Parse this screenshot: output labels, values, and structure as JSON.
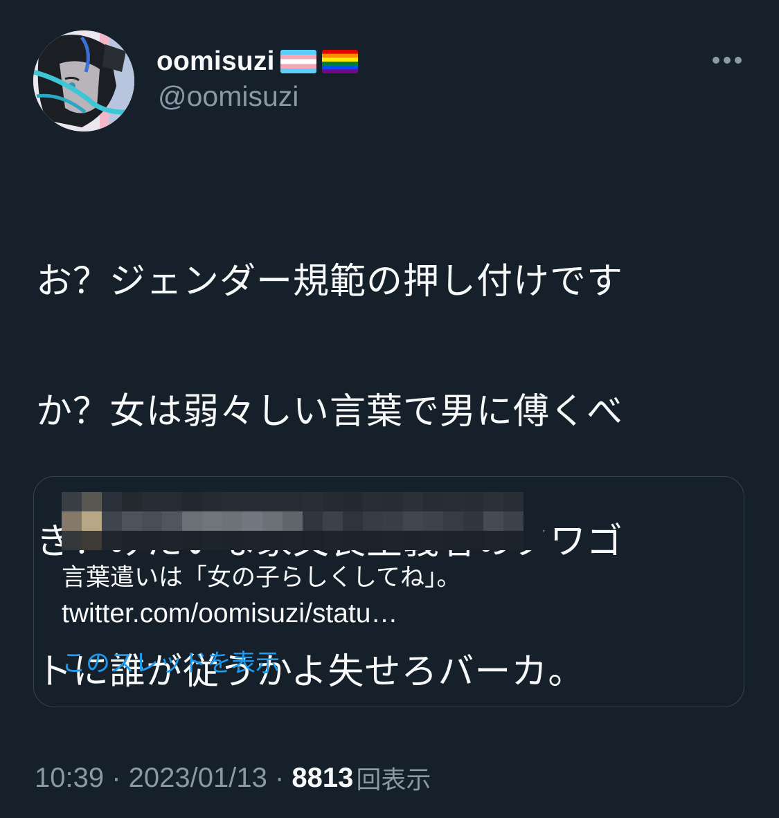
{
  "author": {
    "display_name": "oomisuzi",
    "handle": "@oomisuzi",
    "flags": [
      "transgender-flag",
      "rainbow-flag"
    ]
  },
  "more_menu": {
    "icon": "more-horizontal-icon"
  },
  "tweet": {
    "text_lines": [
      "お？ジェンダー規範の押し付けです",
      "か？女は弱々しい言葉で男に傅くべ",
      "き！みたいな家父長主義者のタワゴ",
      "トに誰が従うかよ失せろバーカ。"
    ]
  },
  "quote": {
    "text": "言葉遣いは「女の子らしくしてね」。",
    "link": "twitter.com/oomisuzi/statu…",
    "show_thread": "このスレッドを表示"
  },
  "meta": {
    "time": "10:39",
    "separator": " · ",
    "date": "2023/01/13",
    "views_count": "8813",
    "views_label": "回表示"
  },
  "colors": {
    "background": "#15202b",
    "text_primary": "#f7f9f9",
    "text_secondary": "#8b98a5",
    "link": "#1d9bf0",
    "border": "#38444d"
  }
}
